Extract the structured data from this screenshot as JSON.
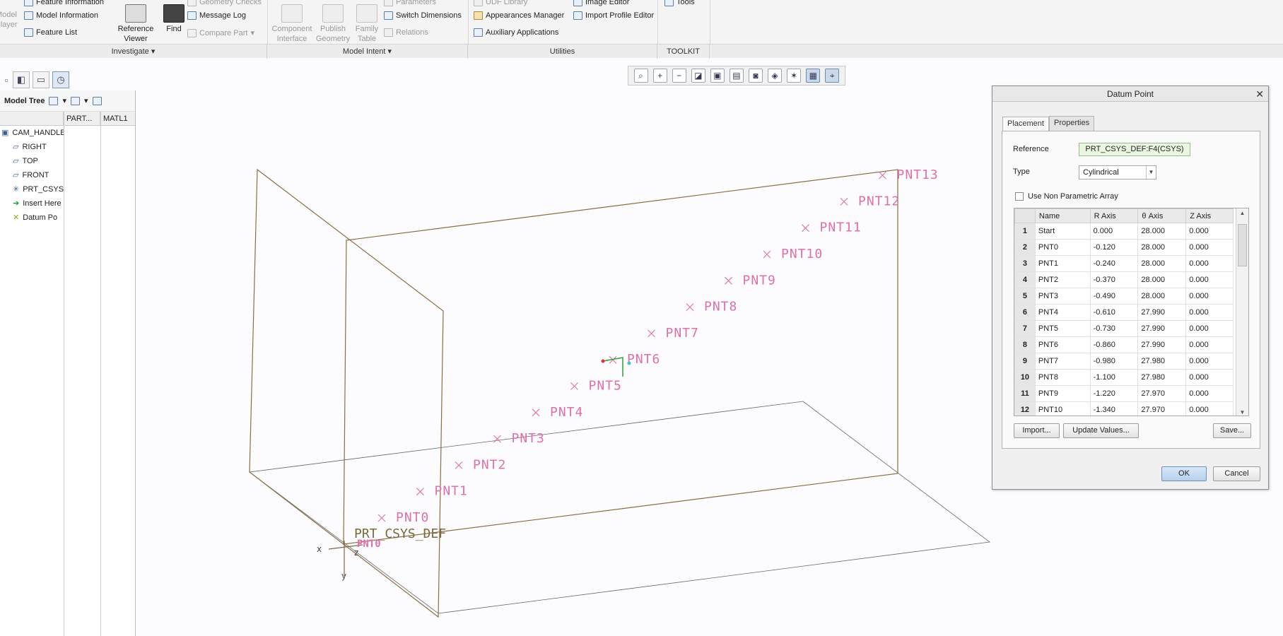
{
  "ribbon": {
    "investigate": {
      "model_player": "Model\nPlayer",
      "feature_information": "Feature Information",
      "model_information": "Model Information",
      "feature_list": "Feature List",
      "reference_viewer": "Reference\nViewer",
      "find": "Find",
      "geometry_checks": "Geometry Checks",
      "message_log": "Message Log",
      "compare_part": "Compare Part"
    },
    "model_intent": {
      "component_interface": "Component\nInterface",
      "publish_geometry": "Publish\nGeometry",
      "family_table": "Family\nTable",
      "parameters": "Parameters",
      "switch_dimensions": "Switch Dimensions",
      "relations": "Relations"
    },
    "utilities": {
      "udf_library": "UDF Library",
      "appearances_manager": "Appearances Manager",
      "auxiliary_applications": "Auxiliary Applications",
      "image_editor": "Image Editor",
      "import_profile_editor": "Import Profile Editor"
    },
    "toolkit": {
      "tools": "Tools"
    },
    "groups": {
      "investigate": "Investigate",
      "model_intent": "Model Intent",
      "utilities": "Utilities",
      "toolkit": "TOOLKIT"
    }
  },
  "model_tree": {
    "title": "Model Tree",
    "columns": [
      "PART...",
      "MATL1"
    ],
    "items": [
      {
        "label": "CAM_HANDLE.",
        "icon": "part-icon"
      },
      {
        "label": "RIGHT",
        "icon": "datum-plane-icon"
      },
      {
        "label": "TOP",
        "icon": "datum-plane-icon"
      },
      {
        "label": "FRONT",
        "icon": "datum-plane-icon"
      },
      {
        "label": "PRT_CSYS",
        "icon": "csys-icon"
      },
      {
        "label": "Insert Here",
        "icon": "insert-arrow-icon"
      },
      {
        "label": "Datum Po",
        "icon": "datum-point-icon"
      }
    ]
  },
  "viewport": {
    "points": [
      "PNT0",
      "PNT1",
      "PNT2",
      "PNT3",
      "PNT4",
      "PNT5",
      "PNT6",
      "PNT7",
      "PNT8",
      "PNT9",
      "PNT10",
      "PNT11",
      "PNT12",
      "PNT13"
    ],
    "csys_label": "PRT_CSYS_DEF",
    "axis_x": "x",
    "axis_y": "y",
    "axis_z": "z",
    "overlap_label": "PNT0",
    "colors": {
      "point": "#e070a8",
      "plane": "#8a6e44",
      "floor": "#666666",
      "csys": "#7a6a3a"
    }
  },
  "dialog": {
    "title": "Datum Point",
    "tabs": [
      "Placement",
      "Properties"
    ],
    "reference_label": "Reference",
    "reference_value": "PRT_CSYS_DEF:F4(CSYS)",
    "type_label": "Type",
    "type_value": "Cylindrical",
    "non_parametric_label": "Use Non Parametric Array",
    "table": {
      "headers": [
        "Name",
        "R Axis",
        "θ Axis",
        "Z Axis"
      ],
      "rows": [
        {
          "n": "1",
          "name": "Start",
          "r": "0.000",
          "t": "28.000",
          "z": "0.000"
        },
        {
          "n": "2",
          "name": "PNT0",
          "r": "-0.120",
          "t": "28.000",
          "z": "0.000"
        },
        {
          "n": "3",
          "name": "PNT1",
          "r": "-0.240",
          "t": "28.000",
          "z": "0.000"
        },
        {
          "n": "4",
          "name": "PNT2",
          "r": "-0.370",
          "t": "28.000",
          "z": "0.000"
        },
        {
          "n": "5",
          "name": "PNT3",
          "r": "-0.490",
          "t": "28.000",
          "z": "0.000"
        },
        {
          "n": "6",
          "name": "PNT4",
          "r": "-0.610",
          "t": "27.990",
          "z": "0.000"
        },
        {
          "n": "7",
          "name": "PNT5",
          "r": "-0.730",
          "t": "27.990",
          "z": "0.000"
        },
        {
          "n": "8",
          "name": "PNT6",
          "r": "-0.860",
          "t": "27.990",
          "z": "0.000"
        },
        {
          "n": "9",
          "name": "PNT7",
          "r": "-0.980",
          "t": "27.980",
          "z": "0.000"
        },
        {
          "n": "10",
          "name": "PNT8",
          "r": "-1.100",
          "t": "27.980",
          "z": "0.000"
        },
        {
          "n": "11",
          "name": "PNT9",
          "r": "-1.220",
          "t": "27.970",
          "z": "0.000"
        },
        {
          "n": "12",
          "name": "PNT10",
          "r": "-1.340",
          "t": "27.970",
          "z": "0.000"
        }
      ]
    },
    "buttons": {
      "import": "Import...",
      "update": "Update Values...",
      "save": "Save...",
      "ok": "OK",
      "cancel": "Cancel"
    }
  }
}
